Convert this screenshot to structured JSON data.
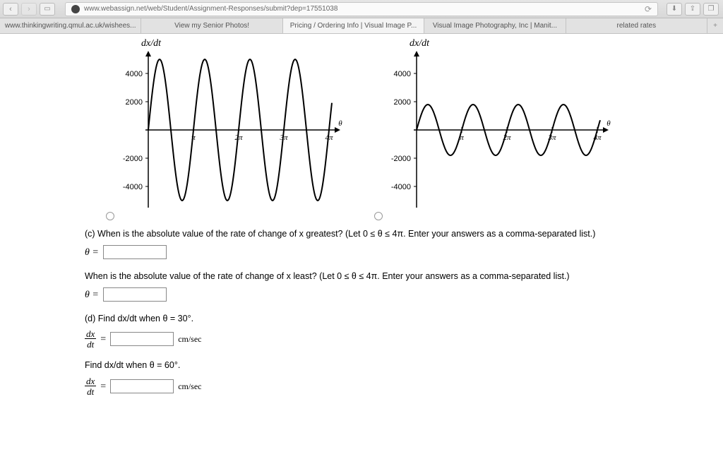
{
  "browser": {
    "url": "www.webassign.net/web/Student/Assignment-Responses/submit?dep=17551038",
    "tabs": [
      "www.thinkingwriting.qmul.ac.uk/wishees...",
      "View my Senior Photos!",
      "Pricing / Ordering Info | Visual Image P...",
      "Visual Image Photography, Inc | Manit...",
      "related rates"
    ]
  },
  "graphs": {
    "ylab": "dx/dt",
    "yticks": [
      "4000",
      "2000",
      "-2000",
      "-4000"
    ],
    "xticks": [
      "π",
      "2π",
      "3π",
      "4π"
    ],
    "xaxis_var": "θ"
  },
  "q": {
    "c1": "(c) When is the absolute value of the rate of change of x greatest? (Let  0 ≤ θ ≤ 4π.  Enter your answers as a comma-separated list.)",
    "theta_eq": "θ =",
    "c2": "When is the absolute value of the rate of change of x least? (Let  0 ≤ θ ≤ 4π.  Enter your answers as a comma-separated list.)",
    "d1": "(d) Find  dx/dt  when  θ = 30°.",
    "d2": "Find  dx/dt  when  θ = 60°.",
    "frac_num": "dx",
    "frac_den": "dt",
    "eq": "=",
    "unit": "cm/sec"
  },
  "chart_data": [
    {
      "type": "line",
      "title": "",
      "xlabel": "θ",
      "ylabel": "dx/dt",
      "xlim": [
        0,
        12.566
      ],
      "ylim": [
        -5000,
        5000
      ],
      "x_ticks": [
        3.1416,
        6.2832,
        9.4248,
        12.566
      ],
      "x_ticklabels": [
        "π",
        "2π",
        "3π",
        "4π"
      ],
      "y_ticks": [
        -4000,
        -2000,
        2000,
        4000
      ],
      "series": [
        {
          "name": "dx/dt",
          "expr": "5000*sin(2θ)",
          "amplitude": 5000,
          "period": "π"
        }
      ]
    },
    {
      "type": "line",
      "title": "",
      "xlabel": "θ",
      "ylabel": "dx/dt",
      "xlim": [
        0,
        12.566
      ],
      "ylim": [
        -5000,
        5000
      ],
      "x_ticks": [
        3.1416,
        6.2832,
        9.4248,
        12.566
      ],
      "x_ticklabels": [
        "π",
        "2π",
        "3π",
        "4π"
      ],
      "y_ticks": [
        -4000,
        -2000,
        2000,
        4000
      ],
      "series": [
        {
          "name": "dx/dt",
          "expr": "1800*sin(2θ)",
          "amplitude": 1800,
          "period": "π"
        }
      ]
    }
  ]
}
